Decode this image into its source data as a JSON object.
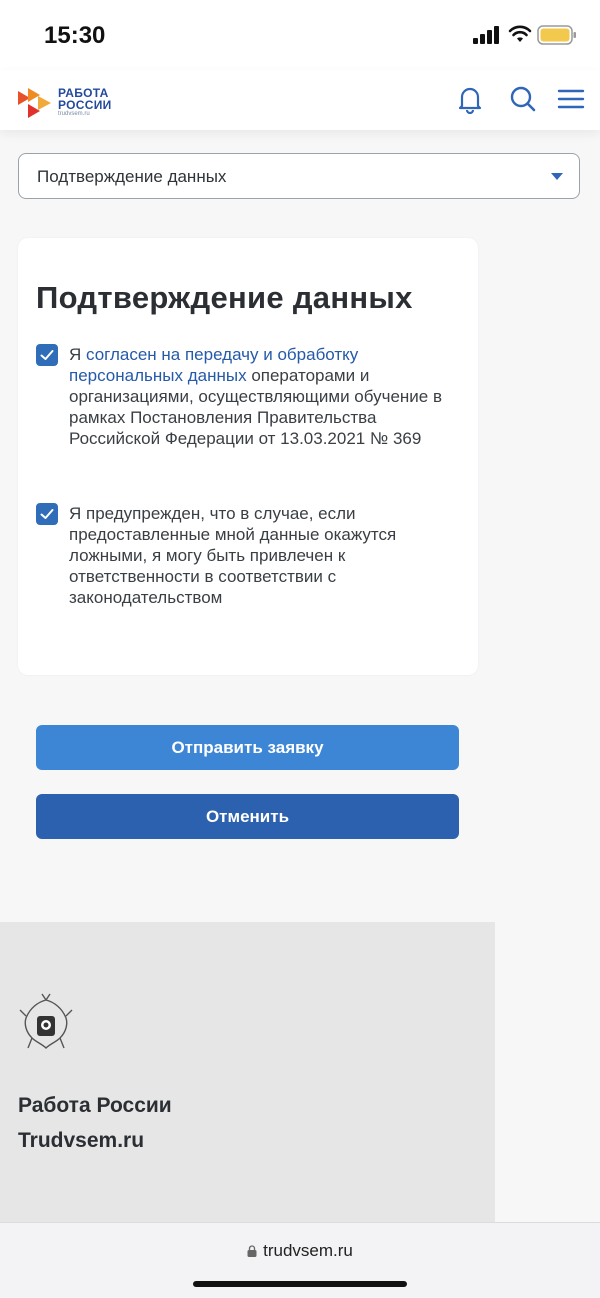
{
  "status_bar": {
    "time": "15:30"
  },
  "header": {
    "logo_line1": "РАБОТА",
    "logo_line2": "РОССИИ",
    "logo_line3": "trudvsem.ru",
    "icons": [
      "bell-icon",
      "search-icon",
      "menu-icon"
    ]
  },
  "dropdown": {
    "selected": "Подтверждение данных"
  },
  "card": {
    "title": "Подтверждение данных",
    "consent1": {
      "prefix": "Я ",
      "link": "согласен на передачу и обработку персональных данных",
      "suffix": " операторами и организациями, осуществляющими обучение в рамках Постановления Правительства Российской Федерации от 13.03.2021 № 369",
      "checked": true
    },
    "consent2": {
      "text": "Я предупрежден, что в случае, если предоставленные мной данные окажутся ложными, я могу быть привлечен к ответственности в соответствии с законодательством",
      "checked": true
    }
  },
  "buttons": {
    "submit": "Отправить заявку",
    "cancel": "Отменить"
  },
  "footer": {
    "line1": "Работа России",
    "line2": "Trudvsem.ru"
  },
  "browser": {
    "url": "trudvsem.ru"
  },
  "colors": {
    "accent": "#2f6db8",
    "submit_button": "#3d86d6",
    "cancel_button": "#2c61af",
    "link": "#245aa8"
  }
}
